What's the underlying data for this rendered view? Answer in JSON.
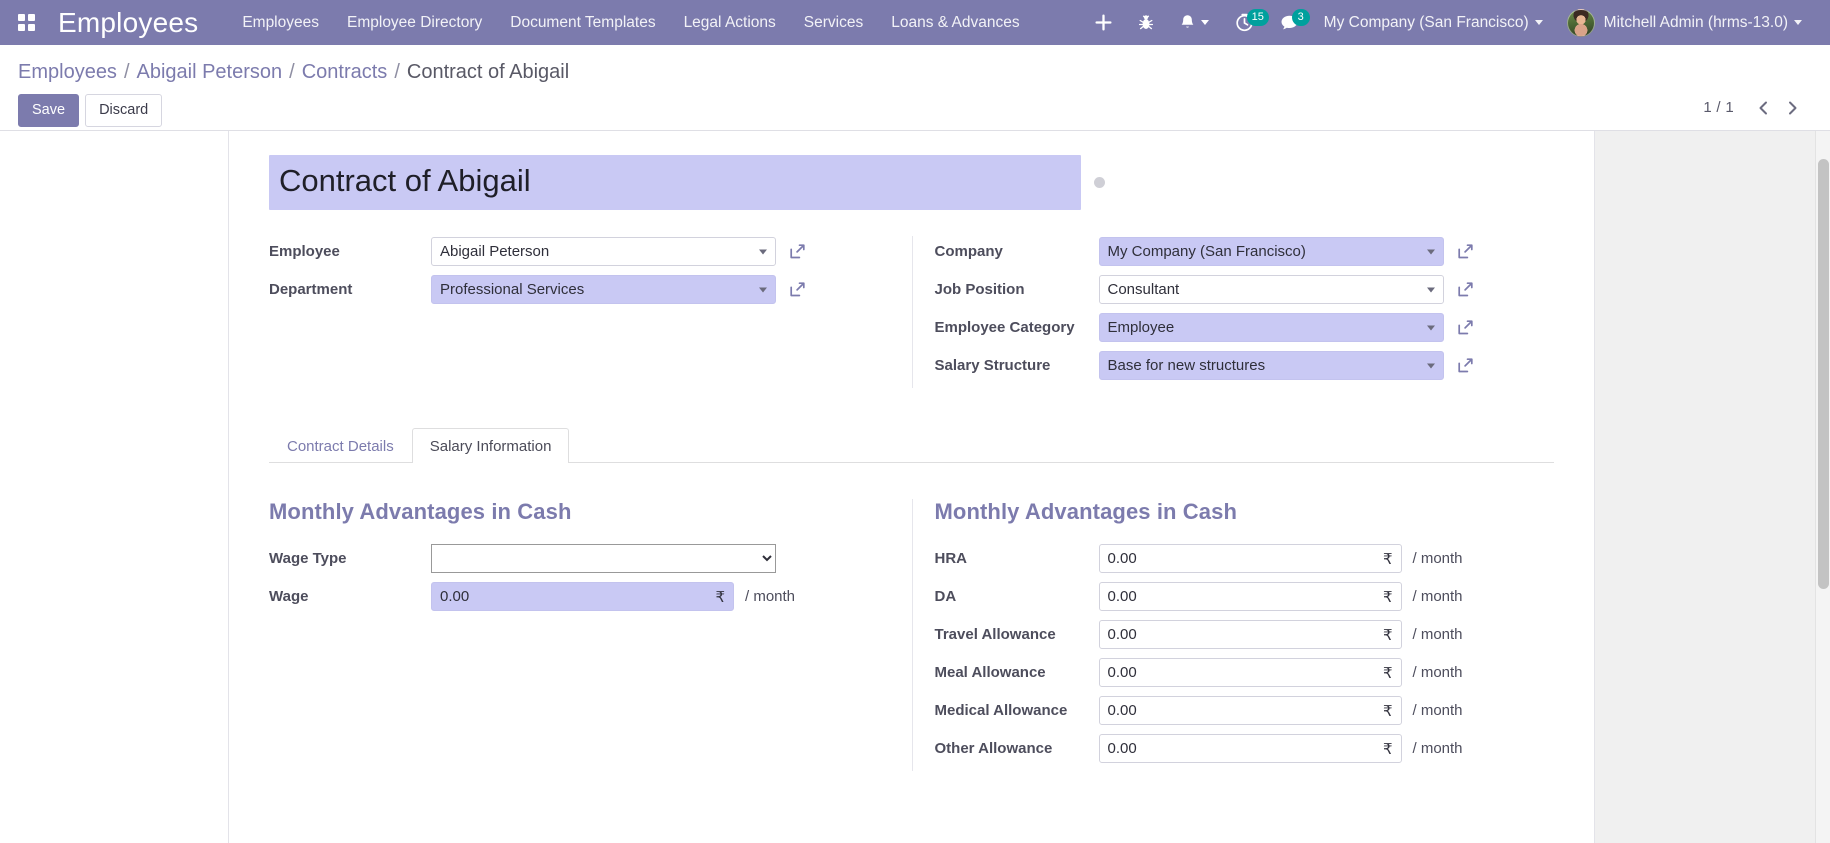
{
  "navbar": {
    "apps_icon": "apps-grid-icon",
    "brand": "Employees",
    "menu_items": [
      {
        "label": "Employees"
      },
      {
        "label": "Employee Directory"
      },
      {
        "label": "Document Templates"
      },
      {
        "label": "Legal Actions"
      },
      {
        "label": "Services"
      },
      {
        "label": "Loans & Advances"
      }
    ],
    "icons": [
      {
        "name": "plus-icon",
        "label": "+"
      },
      {
        "name": "bug-icon",
        "label": ""
      },
      {
        "name": "bell-icon",
        "label": ""
      }
    ],
    "activity": {
      "icon": "clock-icon",
      "count": "15"
    },
    "messages": {
      "icon": "chat-icon",
      "count": "3"
    },
    "company": "My Company (San Francisco)",
    "user": "Mitchell Admin (hrms-13.0)"
  },
  "control_panel": {
    "breadcrumb": [
      {
        "label": "Employees",
        "current": false
      },
      {
        "label": "Abigail Peterson",
        "current": false
      },
      {
        "label": "Contracts",
        "current": false
      },
      {
        "label": "Contract of Abigail",
        "current": true
      }
    ],
    "separator": "/",
    "save_label": "Save",
    "discard_label": "Discard",
    "pager_value": "1 / 1",
    "prev_icon": "chevron-left-icon",
    "next_icon": "chevron-right-icon"
  },
  "form": {
    "title": "Contract of Abigail",
    "left_fields": [
      {
        "label": "Employee",
        "value": "Abigail Peterson",
        "highlighted": false,
        "required": true,
        "external_link": true
      },
      {
        "label": "Department",
        "value": "Professional Services",
        "highlighted": true,
        "required": false,
        "external_link": true
      }
    ],
    "right_fields": [
      {
        "label": "Company",
        "value": "My Company (San Francisco)",
        "highlighted": true,
        "required": true,
        "external_link": true
      },
      {
        "label": "Job Position",
        "value": "Consultant",
        "highlighted": false,
        "required": true,
        "external_link": true
      },
      {
        "label": "Employee Category",
        "value": "Employee",
        "highlighted": true,
        "required": false,
        "external_link": true
      },
      {
        "label": "Salary Structure",
        "value": "Base for new structures",
        "highlighted": true,
        "required": false,
        "external_link": true
      }
    ],
    "tabs": [
      {
        "label": "Contract Details",
        "active": false
      },
      {
        "label": "Salary Information",
        "active": true
      }
    ],
    "salary_tab": {
      "left_section_title": "Monthly Advantages in Cash",
      "right_section_title": "Monthly Advantages in Cash",
      "wage_type_label": "Wage Type",
      "wage_type_value": "",
      "wage_label": "Wage",
      "wage_value": "0.00",
      "currency_symbol": "₹",
      "unit": "/ month",
      "allowances": [
        {
          "label": "HRA",
          "value": "0.00"
        },
        {
          "label": "DA",
          "value": "0.00"
        },
        {
          "label": "Travel Allowance",
          "value": "0.00"
        },
        {
          "label": "Meal Allowance",
          "value": "0.00"
        },
        {
          "label": "Medical Allowance",
          "value": "0.00"
        },
        {
          "label": "Other Allowance",
          "value": "0.00"
        }
      ]
    }
  },
  "colors": {
    "brand_purple": "#7c7bad",
    "highlight": "#c9c9f4",
    "badge_teal": "#00a09d",
    "section_heading": "#7c7bad"
  }
}
